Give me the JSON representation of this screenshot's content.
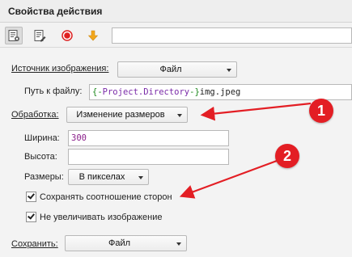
{
  "window": {
    "title": "Свойства действия"
  },
  "toolbar": {
    "buttons": [
      {
        "icon": "properties-icon"
      },
      {
        "icon": "edit-list-icon"
      },
      {
        "icon": "record-icon"
      },
      {
        "icon": "arrow-down-icon"
      }
    ],
    "input_value": ""
  },
  "form": {
    "image_source": {
      "label": "Источник изображения:",
      "value": "Файл"
    },
    "file_path": {
      "label": "Путь к файлу:",
      "value_open": "{-",
      "value_var": "Project.Directory",
      "value_close": "-}",
      "value_rest": "img.jpeg"
    },
    "processing": {
      "label": "Обработка:",
      "value": "Изменение размеров"
    },
    "width": {
      "label": "Ширина:",
      "value": "300"
    },
    "height": {
      "label": "Высота:",
      "value": ""
    },
    "sizes": {
      "label": "Размеры:",
      "value": "В пикселах"
    },
    "keep_ratio": {
      "label": "Сохранять соотношение сторон",
      "checked": true
    },
    "no_enlarge": {
      "label": "Не увеличивать изображение",
      "checked": true
    },
    "save": {
      "label": "Сохранить:",
      "value": "Файл"
    }
  },
  "annotations": [
    {
      "number": "1"
    },
    {
      "number": "2"
    }
  ],
  "colors": {
    "annotation": "#e31e24",
    "variable_brace": "#1e8a1e",
    "variable_name": "#7a2aa8",
    "number_value": "#8a1e8a"
  }
}
